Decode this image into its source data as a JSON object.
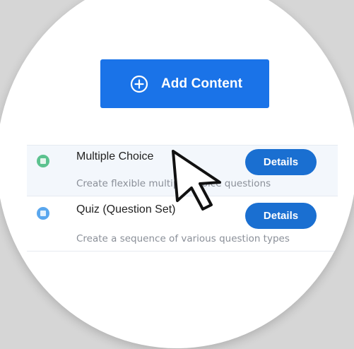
{
  "add_button": {
    "label": "Add Content",
    "icon": "plus-circle-icon",
    "color": "#1a73e8"
  },
  "items": [
    {
      "title": "Multiple Choice",
      "description": "Create flexible multiple choice questions",
      "details_label": "Details",
      "icon": "multiple-choice-icon",
      "icon_color": "#5cc28f",
      "highlighted": true
    },
    {
      "title": "Quiz (Question Set)",
      "description": "Create a sequence of various question types",
      "details_label": "Details",
      "icon": "question-set-icon",
      "icon_color": "#5aa7ee",
      "highlighted": false
    }
  ],
  "colors": {
    "background": "#d6d6d6",
    "details_button": "#1a6fd1",
    "row_highlight": "#f3f7fc"
  }
}
